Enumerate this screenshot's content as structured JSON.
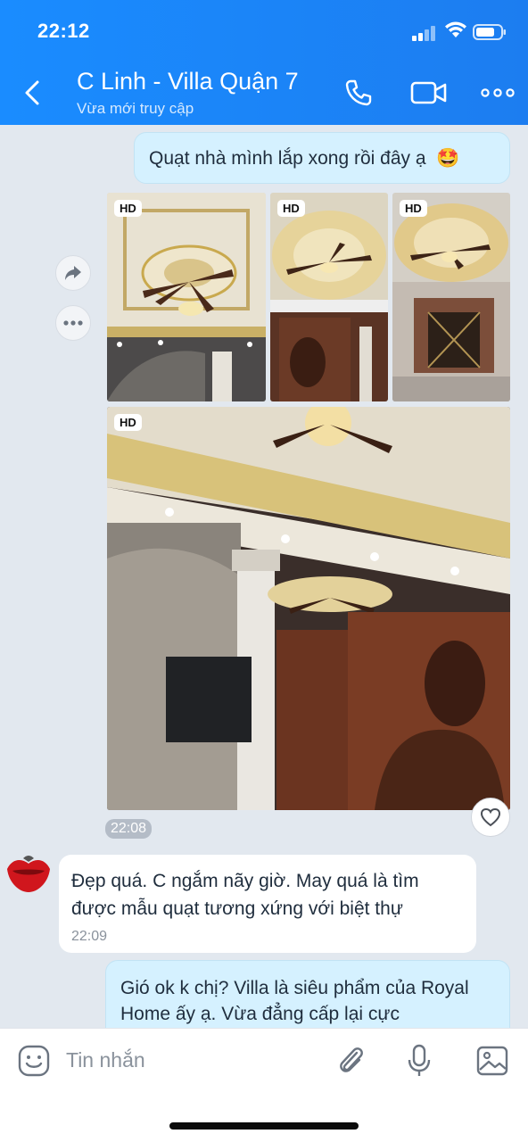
{
  "status_bar": {
    "time": "22:12"
  },
  "header": {
    "title": "C Linh - Villa Quận 7",
    "subtitle": "Vừa mới truy cập"
  },
  "messages": {
    "sent1": {
      "text": "Quạt nhà mình lắp xong rồi đây ạ",
      "emoji": "🤩"
    },
    "photos": {
      "badge": "HD",
      "time": "22:08"
    },
    "recv1": {
      "text": "Đẹp quá. C ngắm nãy giờ. May quá là tìm được mẫu quạt tương xứng với biệt thự",
      "time": "22:09"
    },
    "sent2": {
      "text": "Gió ok k chị? Villa là siêu phẩm của Royal Home ấy ạ. Vừa đẳng cấp lại cực"
    }
  },
  "composer": {
    "placeholder": "Tin nhắn"
  },
  "colors": {
    "header": "#1a8cff",
    "sent_bubble": "#d5f1ff",
    "chat_bg": "#e2e8ef"
  },
  "icons": [
    "back-icon",
    "phone-icon",
    "video-icon",
    "more-icon",
    "forward-icon",
    "ellipsis-icon",
    "heart-icon",
    "sticker-icon",
    "attach-icon",
    "mic-icon",
    "image-icon"
  ]
}
